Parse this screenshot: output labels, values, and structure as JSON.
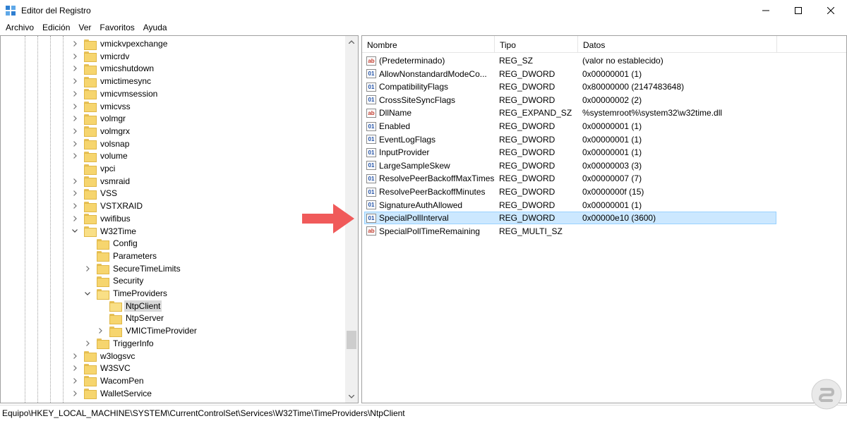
{
  "window": {
    "title": "Editor del Registro",
    "minimize_icon": "minimize-icon",
    "maximize_icon": "maximize-icon",
    "close_icon": "close-icon"
  },
  "menu": [
    "Archivo",
    "Edición",
    "Ver",
    "Favoritos",
    "Ayuda"
  ],
  "tree": [
    {
      "label": "vmickvpexchange",
      "level": 0,
      "expander": ">",
      "selected": false
    },
    {
      "label": "vmicrdv",
      "level": 0,
      "expander": ">",
      "selected": false
    },
    {
      "label": "vmicshutdown",
      "level": 0,
      "expander": ">",
      "selected": false
    },
    {
      "label": "vmictimesync",
      "level": 0,
      "expander": ">",
      "selected": false
    },
    {
      "label": "vmicvmsession",
      "level": 0,
      "expander": ">",
      "selected": false
    },
    {
      "label": "vmicvss",
      "level": 0,
      "expander": ">",
      "selected": false
    },
    {
      "label": "volmgr",
      "level": 0,
      "expander": ">",
      "selected": false
    },
    {
      "label": "volmgrx",
      "level": 0,
      "expander": ">",
      "selected": false
    },
    {
      "label": "volsnap",
      "level": 0,
      "expander": ">",
      "selected": false
    },
    {
      "label": "volume",
      "level": 0,
      "expander": ">",
      "selected": false
    },
    {
      "label": "vpci",
      "level": 0,
      "expander": "",
      "selected": false
    },
    {
      "label": "vsmraid",
      "level": 0,
      "expander": ">",
      "selected": false
    },
    {
      "label": "VSS",
      "level": 0,
      "expander": ">",
      "selected": false
    },
    {
      "label": "VSTXRAID",
      "level": 0,
      "expander": ">",
      "selected": false
    },
    {
      "label": "vwifibus",
      "level": 0,
      "expander": ">",
      "selected": false
    },
    {
      "label": "W32Time",
      "level": 0,
      "expander": "v",
      "selected": false
    },
    {
      "label": "Config",
      "level": 1,
      "expander": "",
      "selected": false
    },
    {
      "label": "Parameters",
      "level": 1,
      "expander": "",
      "selected": false
    },
    {
      "label": "SecureTimeLimits",
      "level": 1,
      "expander": ">",
      "selected": false
    },
    {
      "label": "Security",
      "level": 1,
      "expander": "",
      "selected": false
    },
    {
      "label": "TimeProviders",
      "level": 1,
      "expander": "v",
      "selected": false
    },
    {
      "label": "NtpClient",
      "level": 2,
      "expander": "",
      "selected": true
    },
    {
      "label": "NtpServer",
      "level": 2,
      "expander": "",
      "selected": false
    },
    {
      "label": "VMICTimeProvider",
      "level": 2,
      "expander": ">",
      "selected": false
    },
    {
      "label": "TriggerInfo",
      "level": 1,
      "expander": ">",
      "selected": false
    },
    {
      "label": "w3logsvc",
      "level": 0,
      "expander": ">",
      "selected": false
    },
    {
      "label": "W3SVC",
      "level": 0,
      "expander": ">",
      "selected": false
    },
    {
      "label": "WacomPen",
      "level": 0,
      "expander": ">",
      "selected": false
    },
    {
      "label": "WalletService",
      "level": 0,
      "expander": ">",
      "selected": false
    }
  ],
  "list": {
    "columns": [
      "Nombre",
      "Tipo",
      "Datos"
    ],
    "rows": [
      {
        "name": "(Predeterminado)",
        "type": "REG_SZ",
        "data": "(valor no establecido)",
        "icon": "string-value-icon",
        "kind": "sz",
        "selected": false
      },
      {
        "name": "AllowNonstandardModeCo...",
        "type": "REG_DWORD",
        "data": "0x00000001 (1)",
        "icon": "binary-value-icon",
        "kind": "bin",
        "selected": false
      },
      {
        "name": "CompatibilityFlags",
        "type": "REG_DWORD",
        "data": "0x80000000 (2147483648)",
        "icon": "binary-value-icon",
        "kind": "bin",
        "selected": false
      },
      {
        "name": "CrossSiteSyncFlags",
        "type": "REG_DWORD",
        "data": "0x00000002 (2)",
        "icon": "binary-value-icon",
        "kind": "bin",
        "selected": false
      },
      {
        "name": "DllName",
        "type": "REG_EXPAND_SZ",
        "data": "%systemroot%\\system32\\w32time.dll",
        "icon": "string-value-icon",
        "kind": "sz",
        "selected": false
      },
      {
        "name": "Enabled",
        "type": "REG_DWORD",
        "data": "0x00000001 (1)",
        "icon": "binary-value-icon",
        "kind": "bin",
        "selected": false
      },
      {
        "name": "EventLogFlags",
        "type": "REG_DWORD",
        "data": "0x00000001 (1)",
        "icon": "binary-value-icon",
        "kind": "bin",
        "selected": false
      },
      {
        "name": "InputProvider",
        "type": "REG_DWORD",
        "data": "0x00000001 (1)",
        "icon": "binary-value-icon",
        "kind": "bin",
        "selected": false
      },
      {
        "name": "LargeSampleSkew",
        "type": "REG_DWORD",
        "data": "0x00000003 (3)",
        "icon": "binary-value-icon",
        "kind": "bin",
        "selected": false
      },
      {
        "name": "ResolvePeerBackoffMaxTimes",
        "type": "REG_DWORD",
        "data": "0x00000007 (7)",
        "icon": "binary-value-icon",
        "kind": "bin",
        "selected": false
      },
      {
        "name": "ResolvePeerBackoffMinutes",
        "type": "REG_DWORD",
        "data": "0x0000000f (15)",
        "icon": "binary-value-icon",
        "kind": "bin",
        "selected": false
      },
      {
        "name": "SignatureAuthAllowed",
        "type": "REG_DWORD",
        "data": "0x00000001 (1)",
        "icon": "binary-value-icon",
        "kind": "bin",
        "selected": false
      },
      {
        "name": "SpecialPollInterval",
        "type": "REG_DWORD",
        "data": "0x00000e10 (3600)",
        "icon": "binary-value-icon",
        "kind": "bin",
        "selected": true
      },
      {
        "name": "SpecialPollTimeRemaining",
        "type": "REG_MULTI_SZ",
        "data": "",
        "icon": "string-value-icon",
        "kind": "sz",
        "selected": false
      }
    ]
  },
  "status": {
    "path": "Equipo\\HKEY_LOCAL_MACHINE\\SYSTEM\\CurrentControlSet\\Services\\W32Time\\TimeProviders\\NtpClient"
  },
  "colors": {
    "accent_arrow": "#f05a5a",
    "selection": "#cce8ff",
    "folder": "#f6d56e"
  }
}
